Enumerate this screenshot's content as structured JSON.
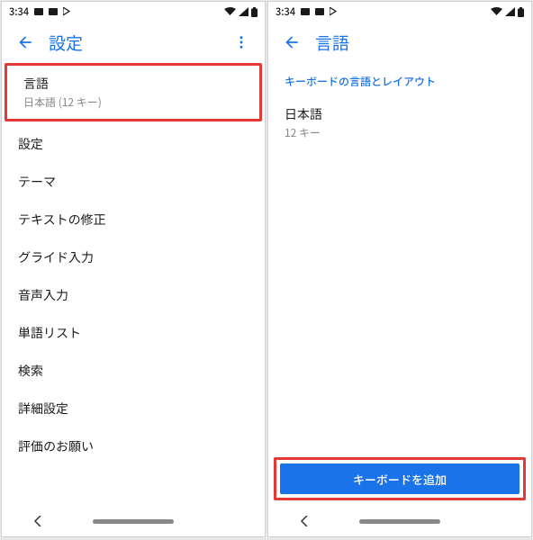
{
  "left": {
    "status": {
      "time": "3:34"
    },
    "appbar": {
      "title": "設定"
    },
    "items": {
      "lang": {
        "title": "言語",
        "subtitle": "日本語 (12 キー)"
      },
      "settings": "設定",
      "theme": "テーマ",
      "text_correction": "テキストの修正",
      "glide": "グライド入力",
      "voice": "音声入力",
      "word_list": "単語リスト",
      "search": "検索",
      "advanced": "詳細設定",
      "feedback": "評価のお願い"
    }
  },
  "right": {
    "status": {
      "time": "3:34"
    },
    "appbar": {
      "title": "言語"
    },
    "section_header": "キーボードの言語とレイアウト",
    "lang_entry": {
      "title": "日本語",
      "subtitle": "12 キー"
    },
    "add_button": "キーボードを追加"
  }
}
